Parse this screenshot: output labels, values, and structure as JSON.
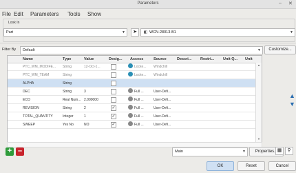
{
  "window": {
    "title": "Parameters",
    "minimize": "–",
    "close": "✕"
  },
  "menu": [
    "File",
    "Edit",
    "Parameters",
    "Tools",
    "Show"
  ],
  "look_in": {
    "label": "Look In",
    "value": "Part",
    "model": "WCN-28013-B1"
  },
  "filter": {
    "label": "Filter By",
    "value": "Default",
    "customize": "Customize..."
  },
  "columns": [
    "Name",
    "Type",
    "Value",
    "Desig...",
    "Access",
    "Source",
    "Descri...",
    "Restri...",
    "Unit Q...",
    "Unit"
  ],
  "rows": [
    {
      "name": "PTC_WM_MODIFE...",
      "type": "String",
      "value": "12-Oct-1...",
      "desig": false,
      "access": "Locke...",
      "source": "Windchill",
      "dim": true
    },
    {
      "name": "PTC_WM_TEAM",
      "type": "String",
      "value": "",
      "desig": false,
      "access": "Locke...",
      "source": "Windchill",
      "dim": true
    },
    {
      "name": "ALPHA",
      "type": "String",
      "value": "",
      "desig": false,
      "access": "",
      "source": "",
      "dim": false,
      "selected": true
    },
    {
      "name": "DEC",
      "type": "String",
      "value": "3",
      "desig": false,
      "access": "Full ...",
      "source": "User-Defi...",
      "dim": false
    },
    {
      "name": "ECO",
      "type": "Real Num...",
      "value": "2.000000",
      "desig": false,
      "access": "Full ...",
      "source": "User-Defi...",
      "dim": false
    },
    {
      "name": "REVISION",
      "type": "String",
      "value": "2",
      "desig": true,
      "access": "Full ...",
      "source": "User-Defi...",
      "dim": false
    },
    {
      "name": "TOTAL_QUANTITY",
      "type": "Integer",
      "value": "1",
      "desig": true,
      "access": "Full ...",
      "source": "User-Defi...",
      "dim": false
    },
    {
      "name": "SWEEP",
      "type": "Yes No",
      "value": "NO",
      "desig": true,
      "access": "Full ...",
      "source": "User-Defi...",
      "dim": false
    }
  ],
  "bottom": {
    "main_select": "Main",
    "properties": "Properties...",
    "ok": "OK",
    "reset": "Reset",
    "cancel": "Cancel"
  },
  "colors": {
    "add": "#2e9b3a",
    "remove": "#c8232c",
    "arrow": "#2a6db0",
    "ok_bg": "#cfe0f3",
    "lock": "#2a8fb5"
  }
}
